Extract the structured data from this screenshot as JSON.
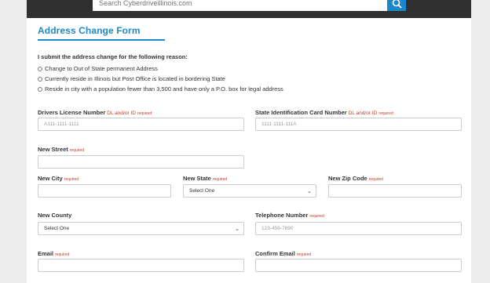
{
  "header": {
    "search_placeholder": "Search Cyberdriveillinois.com"
  },
  "form": {
    "title": "Address Change Form",
    "reason_prompt": "I submit the address change for the following reason:",
    "reasons": [
      "Change to Out of State permanent Address",
      "Currently reside in Illinois but Post Office is located in bordering State",
      "Reside in city with a population fewer than 3,500 and have only a P.O. box for legal address"
    ],
    "dl_label": "Drivers License Number",
    "dl_note": "DL and/or ID",
    "dl_placeholder": "A111-1111-1111",
    "state_id_label": "State Identification Card Number",
    "state_id_note": "DL and/or ID",
    "state_id_placeholder": "1111-1111-111A",
    "required": "required",
    "street_label": "New Street",
    "city_label": "New City",
    "state_label": "New State",
    "state_selected": "Select One",
    "zip_label": "New Zip Code",
    "county_label": "New County",
    "county_selected": "Select One",
    "phone_label": "Telephone Number",
    "phone_placeholder": "123-456-7890",
    "email_label": "Email",
    "confirm_email_label": "Confirm Email"
  },
  "colors": {
    "accent": "#1f88c7",
    "required": "#c0392b",
    "dark_bar": "#2f2f2f"
  },
  "icons": {
    "search": "search-icon",
    "dropdown": "chevron-down-icon"
  }
}
